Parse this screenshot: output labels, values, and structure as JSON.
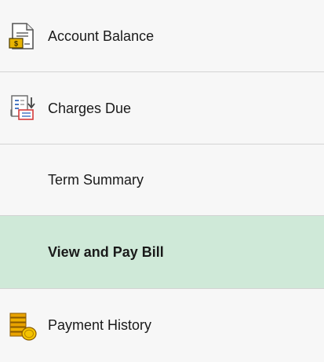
{
  "menu": {
    "items": [
      {
        "label": "Account Balance",
        "icon": "document-dollar-icon"
      },
      {
        "label": "Charges Due",
        "icon": "bill-list-icon"
      },
      {
        "label": "Term Summary",
        "icon": ""
      },
      {
        "label": "View and Pay Bill",
        "icon": "",
        "selected": true
      },
      {
        "label": "Payment History",
        "icon": "coins-stack-icon"
      }
    ]
  },
  "colors": {
    "selected_background": "#cfe9d8",
    "divider": "#d3d3d3",
    "panel_background": "#f7f7f7"
  }
}
